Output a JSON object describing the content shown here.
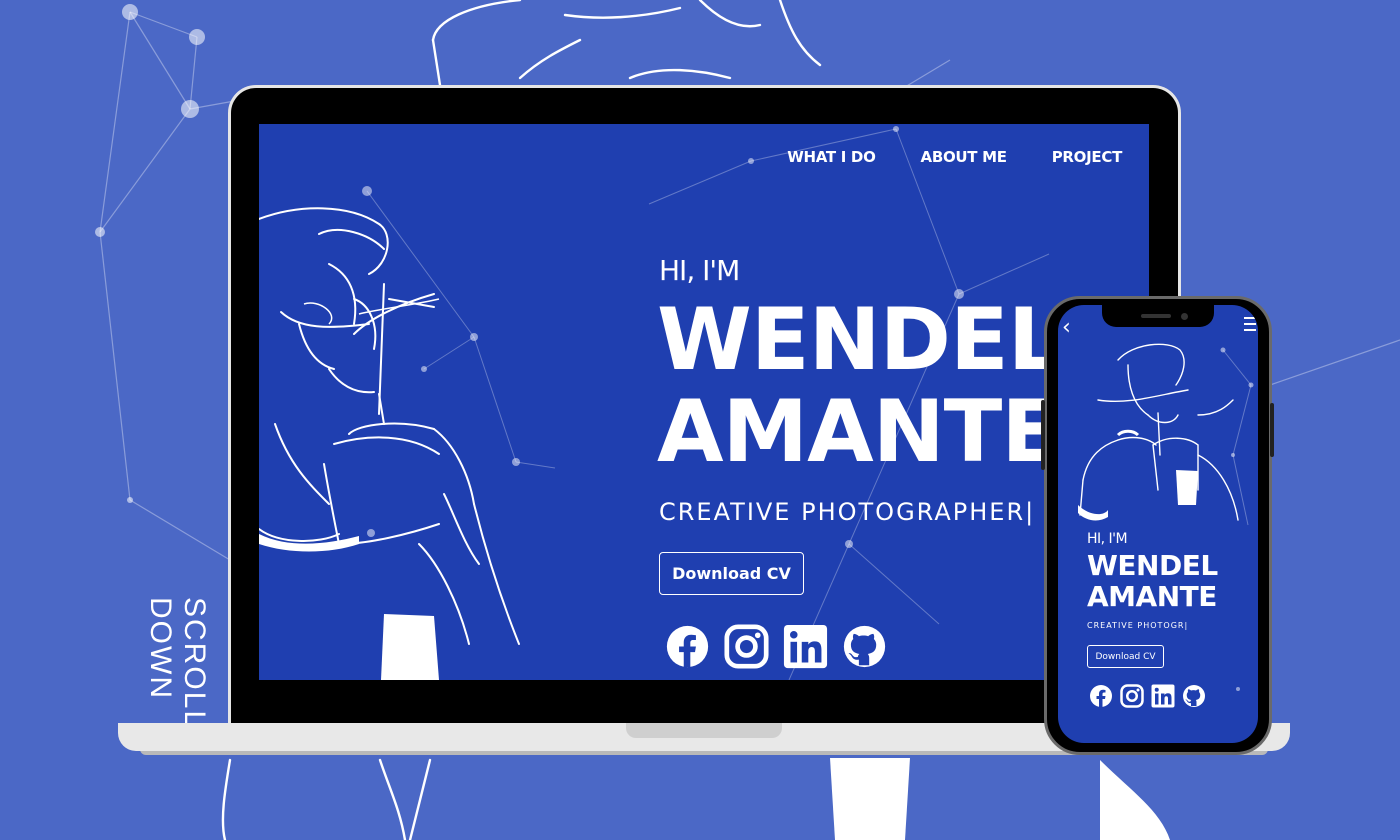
{
  "background": {
    "color": "#4b68c6",
    "scroll_label": "SCROLL DOWN"
  },
  "laptop": {
    "nav": [
      {
        "label": "WHAT I DO"
      },
      {
        "label": "ABOUT ME"
      },
      {
        "label": "PROJECT"
      }
    ],
    "greeting": "HI, I'M",
    "name_line1": "WENDEL",
    "name_line2": "AMANTE",
    "role": "CREATIVE PHOTOGRAPHER|",
    "cv_button": "Download CV",
    "socials": [
      {
        "icon": "facebook-icon"
      },
      {
        "icon": "instagram-icon"
      },
      {
        "icon": "linkedin-icon"
      },
      {
        "icon": "github-icon"
      }
    ],
    "screen_color": "#1f3fb0"
  },
  "phone": {
    "greeting": "HI, I'M",
    "name_line1": "WENDEL",
    "name_line2": "AMANTE",
    "role": "CREATIVE PHOTOGR|",
    "cv_button": "Download CV",
    "back_icon": "back-chevron-icon",
    "menu_icon": "hamburger-menu-icon"
  }
}
